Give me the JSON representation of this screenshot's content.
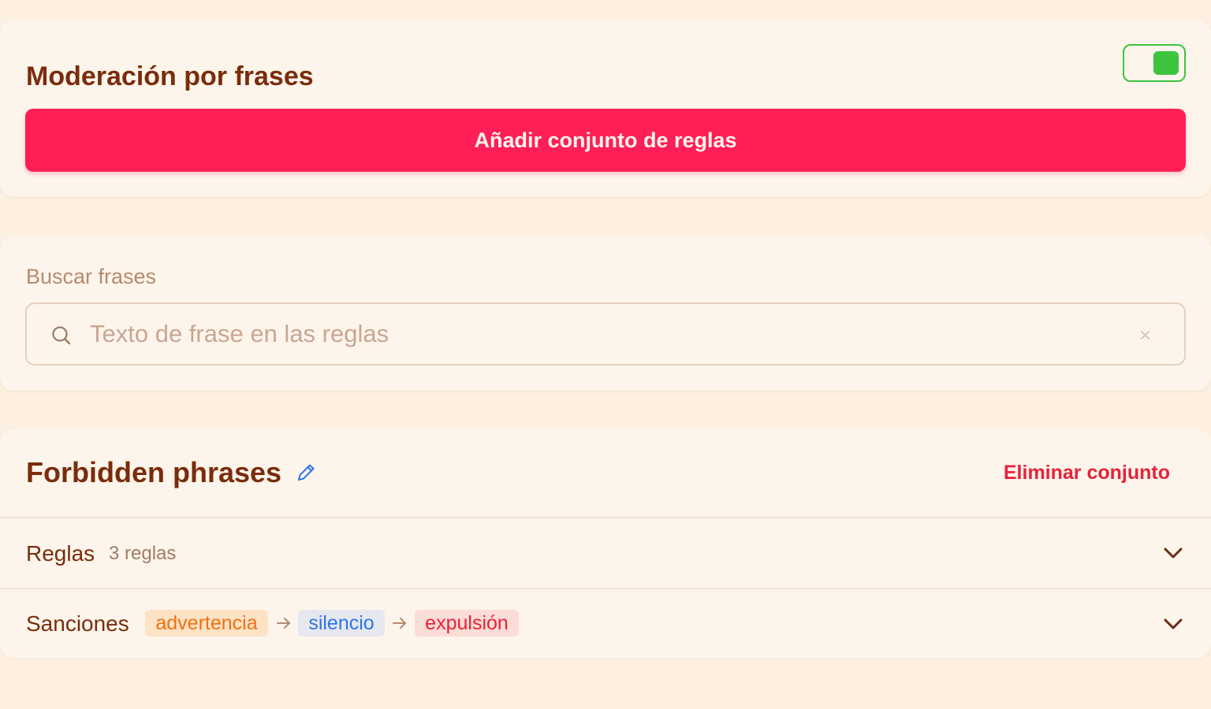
{
  "moderation": {
    "title": "Moderación por frases",
    "enabled": true,
    "add_button_label": "Añadir conjunto de reglas"
  },
  "search": {
    "label": "Buscar frases",
    "placeholder": "Texto de frase en las reglas",
    "value": "",
    "clear_glyph": "×"
  },
  "ruleset": {
    "name": "Forbidden phrases",
    "delete_label": "Eliminar conjunto",
    "rules": {
      "label": "Reglas",
      "count_text": "3 reglas"
    },
    "sanctions": {
      "label": "Sanciones",
      "steps": [
        "advertencia",
        "silencio",
        "expulsión"
      ]
    }
  },
  "colors": {
    "accent": "#ff1f56",
    "toggle_on": "#3cc43f",
    "danger": "#e8213a",
    "heading": "#7a2c0c",
    "page_bg": "#fdf0e0",
    "card_bg": "#fdf5eb"
  },
  "icons": {
    "toggle": "toggle-switch-on",
    "search": "search-icon",
    "clear": "close-icon",
    "edit": "pencil-icon",
    "expand": "chevron-down-icon",
    "arrow": "arrow-right-icon"
  }
}
